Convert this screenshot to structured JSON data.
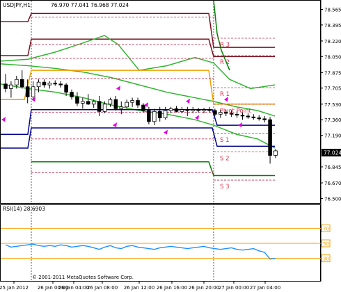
{
  "header": {
    "symbol_tf": "USDJPY,H1",
    "ohlc": "76.970 77.041 76.968 77.024"
  },
  "rsi": {
    "label": "RSI(14) 28.6903",
    "levels": [
      70,
      50,
      30
    ],
    "level_labels": [
      "70",
      "50",
      "30"
    ]
  },
  "copyright": "© 2001-2011 MetaQuotes Software Corp.",
  "colors": {
    "ma_upper_band": "#7a1020",
    "ma_mid": "#31b531",
    "ma_fast": "#f0a000",
    "ma_blue": "#00008b",
    "pivot_orange": "#f5a000",
    "green_band": "#008000",
    "magenta_arrows": "#e000e0",
    "rsi_line": "#1e90ff",
    "rsi_levels": "#f5a000",
    "price_box_bg": "#000000"
  },
  "chart_data": {
    "type": "candlestick",
    "x_ticks": [
      "25 Jan 2012",
      "26 Jan 00:00",
      "26 Jan 04:00",
      "26 Jan 08:00",
      "26 Jan 12:00",
      "26 Jan 16:00",
      "26 Jan 20:00",
      "27 Jan 00:00",
      "27 Jan 04:00"
    ],
    "y_ticks": [
      "78.565",
      "78.395",
      "78.220",
      "78.050",
      "77.875",
      "77.705",
      "77.530",
      "77.360",
      "77.190",
      "77.024",
      "76.845",
      "76.670",
      "76.500"
    ],
    "y_range": [
      76.5,
      78.6
    ],
    "current_price": "77.024",
    "pivot_labels": [
      "R 3",
      "R 2",
      "R 1",
      "Pivot Point",
      "S 1",
      "S 2",
      "S 3"
    ],
    "pivot_levels_day1": {
      "R3": 78.48,
      "R2": 78.18,
      "R1": 78.03,
      "PP": 77.81,
      "S1": 77.44,
      "S2": 77.15,
      "S3": 76.78
    },
    "pivot_levels_day2": {
      "R3": 78.25,
      "R2": 78.06,
      "R1": 77.71,
      "PP": 77.53,
      "S1": 77.21,
      "S2": 77.01,
      "S3": 76.7
    },
    "candles": [
      [
        77.75,
        77.86,
        77.66,
        77.7
      ],
      [
        77.7,
        77.78,
        77.6,
        77.74
      ],
      [
        77.74,
        77.84,
        77.7,
        77.8
      ],
      [
        77.8,
        77.9,
        77.7,
        77.72
      ],
      [
        77.72,
        77.8,
        77.54,
        77.61
      ],
      [
        77.61,
        77.78,
        77.57,
        77.72
      ],
      [
        77.72,
        77.8,
        77.66,
        77.77
      ],
      [
        77.77,
        77.8,
        77.71,
        77.74
      ],
      [
        77.74,
        77.78,
        77.7,
        77.76
      ],
      [
        77.76,
        77.79,
        77.73,
        77.75
      ],
      [
        77.75,
        77.78,
        77.71,
        77.74
      ],
      [
        77.74,
        77.76,
        77.62,
        77.66
      ],
      [
        77.66,
        77.69,
        77.58,
        77.61
      ],
      [
        77.61,
        77.66,
        77.51,
        77.54
      ],
      [
        77.54,
        77.6,
        77.48,
        77.56
      ],
      [
        77.56,
        77.64,
        77.52,
        77.53
      ],
      [
        77.53,
        77.58,
        77.49,
        77.56
      ],
      [
        77.56,
        77.62,
        77.4,
        77.45
      ],
      [
        77.45,
        77.56,
        77.43,
        77.53
      ],
      [
        77.53,
        77.6,
        77.5,
        77.58
      ],
      [
        77.58,
        77.62,
        77.46,
        77.48
      ],
      [
        77.48,
        77.56,
        77.42,
        77.5
      ],
      [
        77.5,
        77.58,
        77.48,
        77.55
      ],
      [
        77.55,
        77.6,
        77.5,
        77.57
      ],
      [
        77.57,
        77.6,
        77.49,
        77.52
      ],
      [
        77.52,
        77.54,
        77.44,
        77.46
      ],
      [
        77.46,
        77.5,
        77.31,
        77.34
      ],
      [
        77.34,
        77.48,
        77.3,
        77.45
      ],
      [
        77.45,
        77.5,
        77.34,
        77.38
      ],
      [
        77.38,
        77.5,
        77.36,
        77.46
      ],
      [
        77.46,
        77.5,
        77.43,
        77.48
      ],
      [
        77.48,
        77.51,
        77.44,
        77.45
      ],
      [
        77.45,
        77.5,
        77.43,
        77.47
      ],
      [
        77.47,
        77.5,
        77.4,
        77.46
      ],
      [
        77.46,
        77.5,
        77.43,
        77.47
      ],
      [
        77.47,
        77.49,
        77.44,
        77.46
      ],
      [
        77.46,
        77.49,
        77.43,
        77.47
      ],
      [
        77.47,
        77.5,
        77.44,
        77.46
      ],
      [
        77.46,
        77.48,
        77.4,
        77.42
      ],
      [
        77.42,
        77.47,
        77.38,
        77.44
      ],
      [
        77.44,
        77.47,
        77.4,
        77.43
      ],
      [
        77.43,
        77.46,
        77.39,
        77.42
      ],
      [
        77.42,
        77.45,
        77.38,
        77.41
      ],
      [
        77.41,
        77.44,
        77.36,
        77.4
      ],
      [
        77.4,
        77.43,
        77.37,
        77.39
      ],
      [
        77.39,
        77.42,
        77.36,
        77.38
      ],
      [
        77.38,
        77.41,
        77.35,
        77.37
      ],
      [
        77.37,
        77.4,
        77.33,
        77.36
      ],
      [
        77.36,
        77.39,
        76.88,
        76.97
      ],
      [
        76.97,
        77.04,
        76.94,
        77.02
      ]
    ],
    "rsi_values": [
      48,
      45,
      46,
      47,
      48,
      49,
      47,
      46,
      47,
      46,
      48,
      47,
      45,
      46,
      47,
      46,
      44,
      42,
      45,
      47,
      44,
      43,
      46,
      47,
      45,
      44,
      43,
      42,
      44,
      45,
      46,
      45,
      44,
      43,
      44,
      45,
      46,
      44,
      43,
      42,
      43,
      44,
      42,
      41,
      42,
      43,
      40,
      38,
      29,
      30
    ]
  }
}
